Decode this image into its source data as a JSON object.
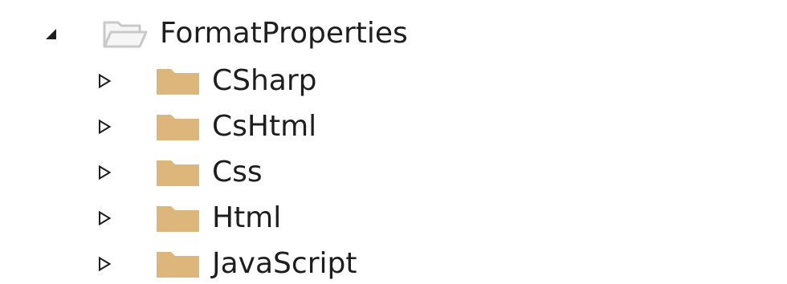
{
  "tree": {
    "root": {
      "label": "FormatProperties",
      "expanded": true,
      "expander_icon": "triangle-expanded-icon",
      "folder_icon": "folder-open-icon"
    },
    "children": [
      {
        "label": "CSharp",
        "expanded": false,
        "expander_icon": "triangle-collapsed-icon",
        "folder_icon": "folder-closed-icon"
      },
      {
        "label": "CsHtml",
        "expanded": false,
        "expander_icon": "triangle-collapsed-icon",
        "folder_icon": "folder-closed-icon"
      },
      {
        "label": "Css",
        "expanded": false,
        "expander_icon": "triangle-collapsed-icon",
        "folder_icon": "folder-closed-icon"
      },
      {
        "label": "Html",
        "expanded": false,
        "expander_icon": "triangle-collapsed-icon",
        "folder_icon": "folder-closed-icon"
      },
      {
        "label": "JavaScript",
        "expanded": false,
        "expander_icon": "triangle-collapsed-icon",
        "folder_icon": "folder-closed-icon"
      }
    ],
    "colors": {
      "text": "#1e1e1e",
      "folder_fill": "#dcb67a",
      "folder_open_fill": "#f6f6f6",
      "folder_open_stroke": "#c9c9c9",
      "expander": "#1e1e1e"
    }
  }
}
